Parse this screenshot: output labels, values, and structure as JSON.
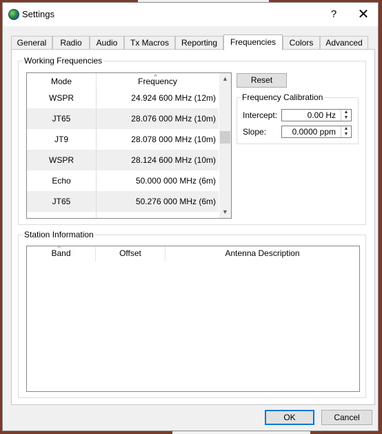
{
  "window": {
    "title": "Settings",
    "help": "?",
    "close": "✕"
  },
  "tabs": [
    {
      "label": "General"
    },
    {
      "label": "Radio"
    },
    {
      "label": "Audio"
    },
    {
      "label": "Tx Macros"
    },
    {
      "label": "Reporting"
    },
    {
      "label": "Frequencies",
      "active": true
    },
    {
      "label": "Colors"
    },
    {
      "label": "Advanced"
    }
  ],
  "working": {
    "title": "Working Frequencies",
    "columns": [
      "Mode",
      "Frequency"
    ],
    "rows": [
      {
        "mode": "WSPR",
        "freq": "24.924 600 MHz (12m)"
      },
      {
        "mode": "JT65",
        "freq": "28.076 000 MHz (10m)"
      },
      {
        "mode": "JT9",
        "freq": "28.078 000 MHz (10m)"
      },
      {
        "mode": "WSPR",
        "freq": "28.124 600 MHz (10m)"
      },
      {
        "mode": "Echo",
        "freq": "50.000 000 MHz (6m)"
      },
      {
        "mode": "JT65",
        "freq": "50.276 000 MHz (6m)"
      }
    ],
    "reset": "Reset"
  },
  "calibration": {
    "title": "Frequency Calibration",
    "intercept_label": "Intercept:",
    "intercept_value": "0.00 Hz",
    "slope_label": "Slope:",
    "slope_value": "0.0000 ppm"
  },
  "station": {
    "title": "Station Information",
    "columns": [
      "Band",
      "Offset",
      "Antenna Description"
    ]
  },
  "footer": {
    "ok": "OK",
    "cancel": "Cancel"
  },
  "colors": {
    "accent": "#0078d7",
    "alt_row": "#efefef"
  }
}
